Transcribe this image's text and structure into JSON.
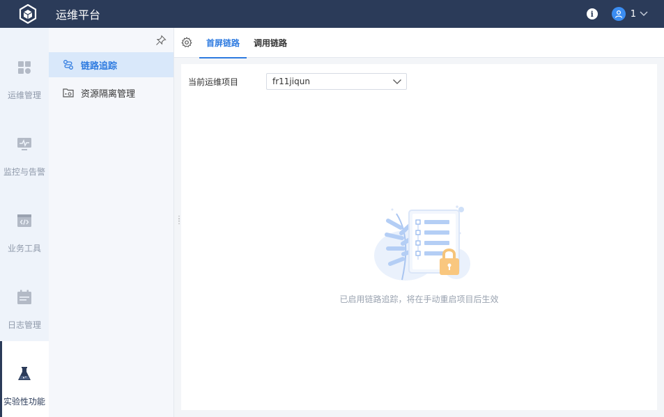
{
  "header": {
    "title": "运维平台",
    "user_name": "1",
    "icons": {
      "logo": "cube-logo-icon",
      "info": "info-icon",
      "user": "user-avatar-icon",
      "chevron": "chevron-down-icon"
    }
  },
  "rail": {
    "items": [
      {
        "label": "运维管理",
        "icon": "grid-apps-icon"
      },
      {
        "label": "监控与告警",
        "icon": "monitor-pulse-icon"
      },
      {
        "label": "业务工具",
        "icon": "code-window-icon"
      },
      {
        "label": "日志管理",
        "icon": "calendar-log-icon"
      },
      {
        "label": "实验性功能",
        "icon": "flask-icon",
        "active": true
      }
    ]
  },
  "subnav": {
    "items": [
      {
        "label": "链路追踪",
        "icon": "link-trace-icon",
        "active": true
      },
      {
        "label": "资源隔离管理",
        "icon": "folder-gear-icon"
      }
    ]
  },
  "tabs": [
    {
      "label": "首屏链路",
      "active": true
    },
    {
      "label": "调用链路"
    }
  ],
  "form": {
    "project_label": "当前运维项目",
    "project_value": "fr11jiqun"
  },
  "empty_state": {
    "message": "已启用链路追踪，将在手动重启项目后生效"
  },
  "colors": {
    "header_bg": "#2b3b59",
    "accent": "#2e7be0",
    "rail_bg": "#eef3fa",
    "active_sub_bg": "#d9e8fa"
  }
}
